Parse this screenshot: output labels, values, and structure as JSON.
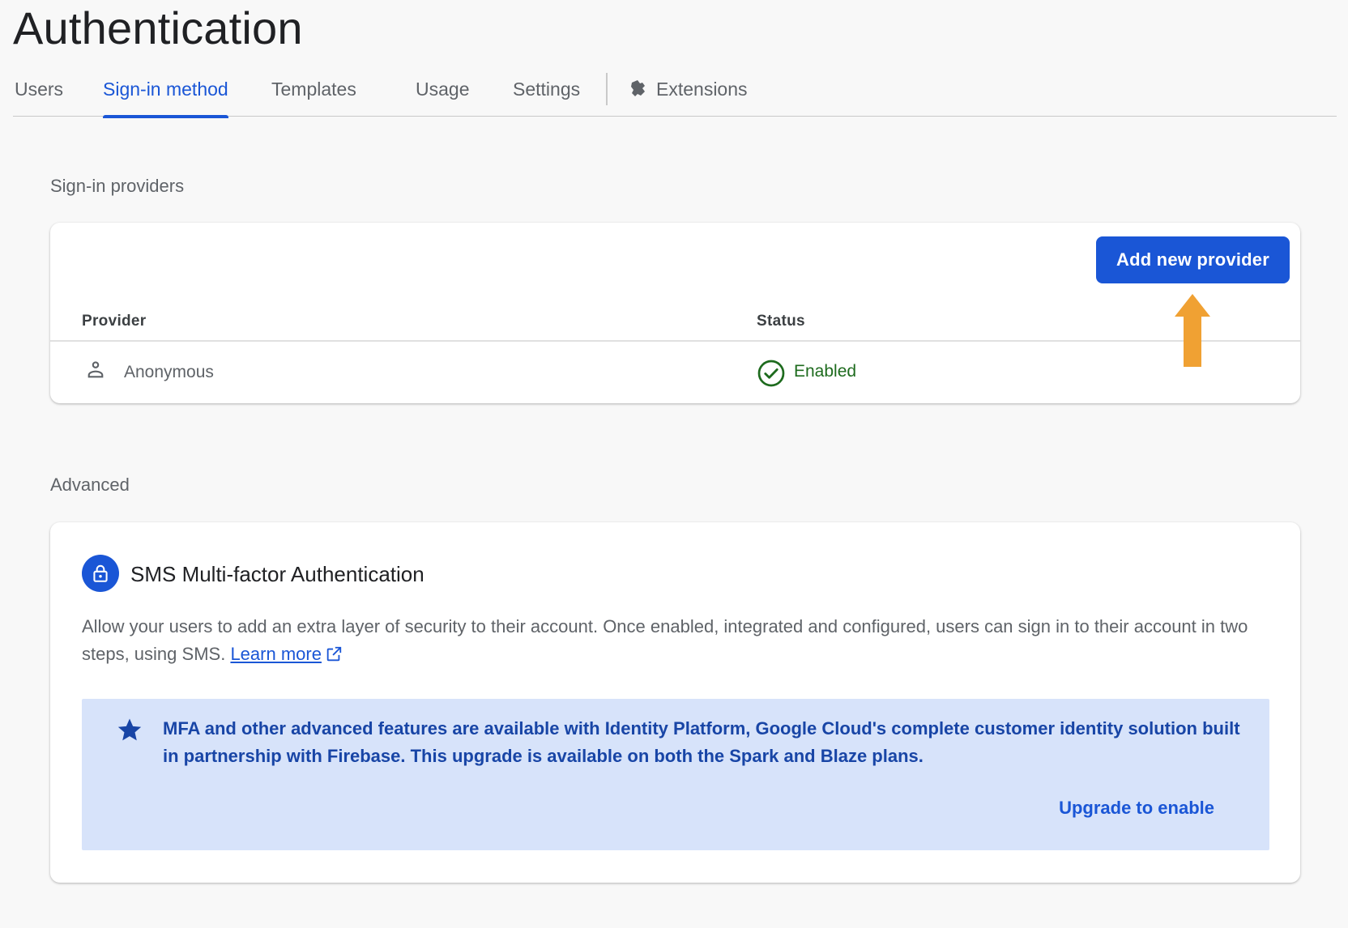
{
  "page": {
    "title": "Authentication"
  },
  "tabs": [
    {
      "label": "Users"
    },
    {
      "label": "Sign-in method"
    },
    {
      "label": "Templates"
    },
    {
      "label": "Usage"
    },
    {
      "label": "Settings"
    },
    {
      "label": "Extensions",
      "icon": "extensions-icon"
    }
  ],
  "active_tab": "Sign-in method",
  "providers_section": {
    "label": "Sign-in providers",
    "add_button_label": "Add new provider",
    "columns": [
      "Provider",
      "Status"
    ],
    "rows": [
      {
        "provider": "Anonymous",
        "provider_icon": "person-icon",
        "status": "Enabled",
        "status_icon": "check-circle-icon"
      }
    ]
  },
  "advanced_section": {
    "label": "Advanced",
    "mfa_title": "SMS Multi-factor Authentication",
    "mfa_description": "Allow your users to add an extra layer of security to their account. Once enabled, integrated and configured, users can sign in to their account in two steps, using SMS.",
    "learn_more_label": "Learn more",
    "upgrade_text": "MFA and other advanced features are available with Identity Platform, Google Cloud's complete customer identity solution built in partnership with Firebase. This upgrade is available on both the Spark and Blaze plans.",
    "upgrade_link_label": "Upgrade to enable"
  },
  "colors": {
    "accent": "#1a56d6",
    "status_enabled": "#1e6b1e",
    "upgrade_bg": "#d7e3fa",
    "annotation_arrow": "#f0a133"
  }
}
